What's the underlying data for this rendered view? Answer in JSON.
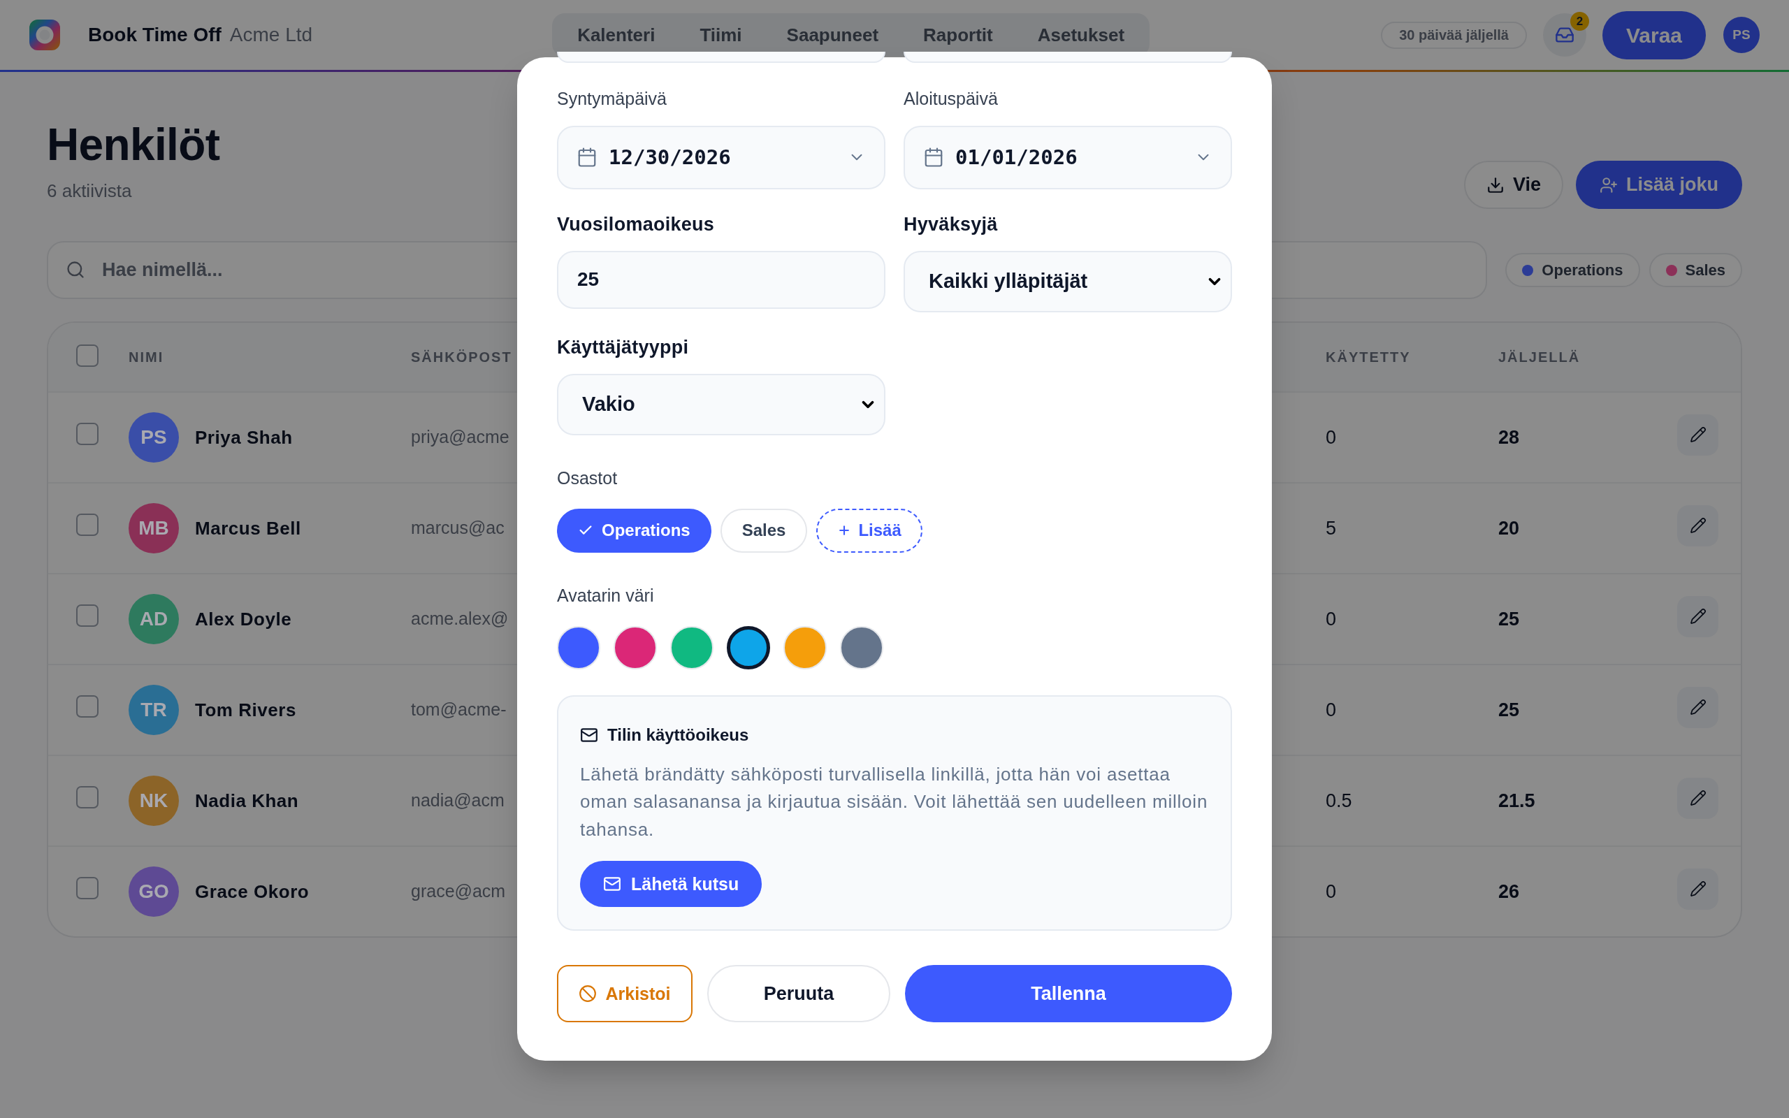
{
  "app": {
    "name": "Book Time Off",
    "org": "Acme Ltd"
  },
  "nav": [
    {
      "label": "Kalenteri",
      "selected": false
    },
    {
      "label": "Tiimi",
      "selected": false
    },
    {
      "label": "Saapuneet",
      "selected": false
    },
    {
      "label": "Raportit",
      "selected": false
    },
    {
      "label": "Asetukset",
      "selected": false
    }
  ],
  "header": {
    "days_left": "30 päivää jäljellä",
    "inbox_badge": "2",
    "book_button": "Varaa",
    "user_initials": "PS"
  },
  "page": {
    "title": "Henkilöt",
    "subtitle": "6 aktiivista",
    "export_button": "Vie",
    "add_button": "Lisää joku",
    "search": {
      "placeholder": "Hae nimellä..."
    },
    "filters": [
      {
        "label": "Operations",
        "color": "#2c3c96"
      },
      {
        "label": "Sales",
        "color": "#8c3058"
      }
    ]
  },
  "table": {
    "select_all": false,
    "columns": [
      "NIMI",
      "SÄHKÖPOST",
      "KÄYTETTY",
      "JÄLJELLÄ"
    ],
    "rows": [
      {
        "initials": "PS",
        "name": "Priya Shah",
        "email": "priya@acme",
        "color": "#3a4ea8",
        "used": "0",
        "remaining": "28",
        "checked": false
      },
      {
        "initials": "MB",
        "name": "Marcus Bell",
        "email": "marcus@ac",
        "color": "#8a3056",
        "used": "5",
        "remaining": "20",
        "checked": false
      },
      {
        "initials": "AD",
        "name": "Alex Doyle",
        "email": "acme.alex@",
        "color": "#2e7a5e",
        "used": "0",
        "remaining": "25",
        "checked": false
      },
      {
        "initials": "TR",
        "name": "Tom Rivers",
        "email": "tom@acme-",
        "color": "#2a6e94",
        "used": "0",
        "remaining": "25",
        "checked": false
      },
      {
        "initials": "NK",
        "name": "Nadia Khan",
        "email": "nadia@acm",
        "color": "#8c6428",
        "used": "0.5",
        "remaining": "21.5",
        "checked": false
      },
      {
        "initials": "GO",
        "name": "Grace Okoro",
        "email": "grace@acm",
        "color": "#5e4a94",
        "used": "0",
        "remaining": "26",
        "checked": false
      }
    ]
  },
  "modal": {
    "fields": [
      {
        "label": "Syntymäpäivä",
        "kind": "date",
        "value": "12/30/2026"
      },
      {
        "label": "Aloituspäivä",
        "kind": "date",
        "value": "01/01/2026"
      },
      {
        "label": "Vuosilomaoikeus",
        "kind": "number",
        "value": "25"
      },
      {
        "label": "Hyväksyjä",
        "kind": "select",
        "value": "Kaikki ylläpitäjät"
      },
      {
        "label": "Käyttäjätyyppi",
        "kind": "select",
        "value": "Vakio"
      }
    ],
    "departments": {
      "label": "Osastot",
      "items": [
        {
          "label": "Operations",
          "selected": true
        },
        {
          "label": "Sales",
          "selected": false
        }
      ],
      "add_label": "Lisää"
    },
    "avatar_color": {
      "label": "Avatarin väri",
      "swatches": [
        {
          "color": "#3d5afe",
          "selected": false
        },
        {
          "color": "#db2777",
          "selected": false
        },
        {
          "color": "#10b981",
          "selected": false
        },
        {
          "color": "#0ea5e9",
          "selected": true
        },
        {
          "color": "#f59e0b",
          "selected": false
        },
        {
          "color": "#64748b",
          "selected": false
        }
      ]
    },
    "access": {
      "title": "Tilin käyttöoikeus",
      "text": "Lähetä brändätty sähköposti turvallisella linkillä, jotta hän voi asettaa oman salasanansa ja kirjautua sisään. Voit lähettää sen uudelleen milloin tahansa.",
      "button": "Lähetä kutsu"
    },
    "actions": [
      {
        "label": "Arkistoi",
        "kind": "danger"
      },
      {
        "label": "Peruuta",
        "kind": "secondary"
      },
      {
        "label": "Tallenna",
        "kind": "primary"
      }
    ]
  }
}
